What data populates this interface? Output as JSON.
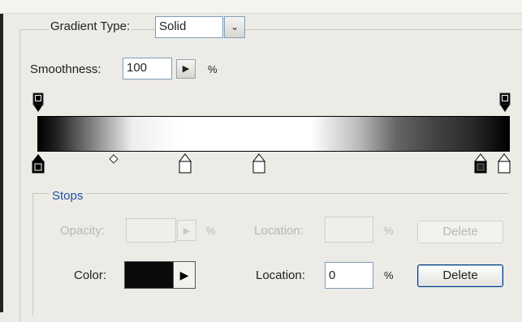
{
  "gradient_type": {
    "label": "Gradient Type:",
    "value": "Solid",
    "dropdown_glyph": "⌄"
  },
  "smoothness": {
    "label": "Smoothness:",
    "value": "100",
    "step_glyph": "▶",
    "unit": "%"
  },
  "stops": {
    "title": "Stops",
    "opacity": {
      "label": "Opacity:",
      "value": "",
      "unit": "%",
      "enabled": false
    },
    "opacity_location": {
      "label": "Location:",
      "value": "",
      "unit": "%",
      "enabled": false
    },
    "opacity_delete": {
      "label": "Delete",
      "enabled": false
    },
    "color": {
      "label": "Color:",
      "swatch": "#0a0a0a",
      "arrow_glyph": "▶"
    },
    "color_location": {
      "label": "Location:",
      "value": "0",
      "unit": "%"
    },
    "color_delete": {
      "label": "Delete"
    }
  },
  "gradient_bar": {
    "opacity_stops": [
      {
        "color": "#000000"
      },
      {
        "color": "#000000"
      }
    ],
    "color_stops": [
      {
        "color": "#000000",
        "selected": true
      },
      {
        "color": "#ffffff"
      },
      {
        "color": "#ffffff"
      },
      {
        "color": "#000000"
      },
      {
        "color": "#ffffff"
      }
    ]
  }
}
